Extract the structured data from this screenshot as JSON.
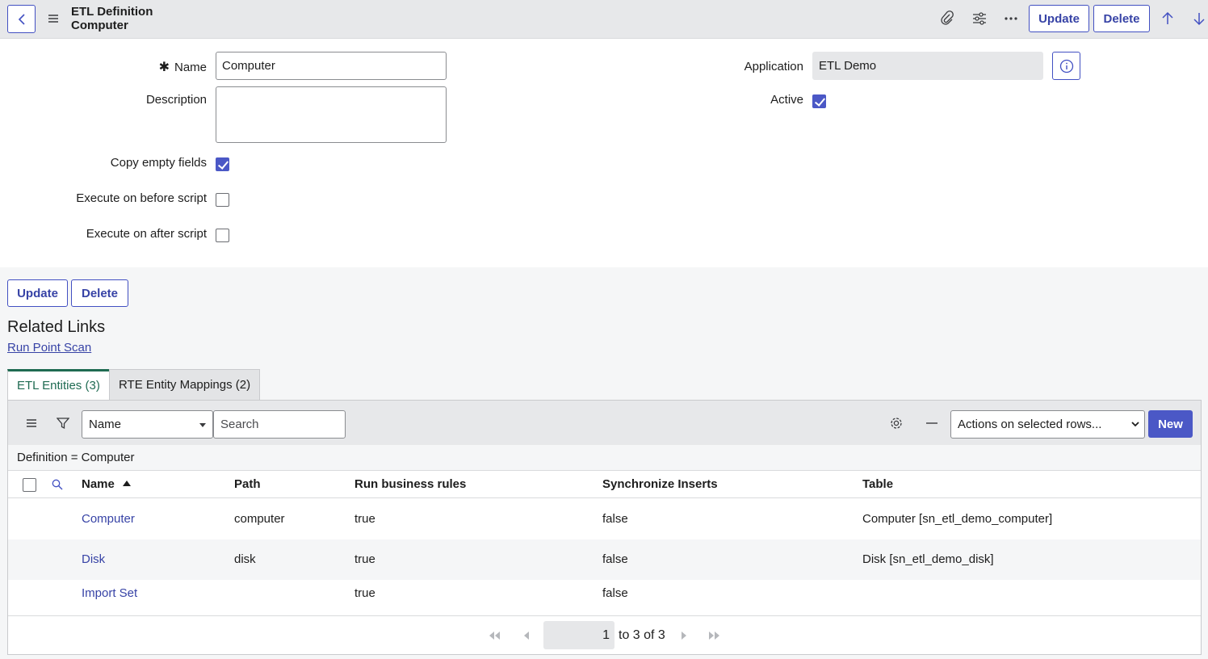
{
  "header": {
    "title_line1": "ETL Definition",
    "title_line2": "Computer",
    "update_label": "Update",
    "delete_label": "Delete"
  },
  "form": {
    "name_label": "Name",
    "name_required_marker": "✱",
    "name_value": "Computer",
    "description_label": "Description",
    "description_value": "",
    "copy_empty_label": "Copy empty fields",
    "copy_empty_checked": true,
    "exec_before_label": "Execute on before script",
    "exec_before_checked": false,
    "exec_after_label": "Execute on after script",
    "exec_after_checked": false,
    "application_label": "Application",
    "application_value": "ETL Demo",
    "active_label": "Active",
    "active_checked": true
  },
  "bottom_buttons": {
    "update_label": "Update",
    "delete_label": "Delete"
  },
  "related": {
    "title": "Related Links",
    "link_label": "Run Point Scan"
  },
  "tabs": [
    {
      "label": "ETL Entities (3)",
      "active": true
    },
    {
      "label": "RTE Entity Mappings (2)",
      "active": false
    }
  ],
  "list": {
    "search_field": "Name",
    "search_placeholder": "Search",
    "actions_select": "Actions on selected rows...",
    "new_label": "New",
    "breadcrumb": "Definition = Computer",
    "columns": [
      "Name",
      "Path",
      "Run business rules",
      "Synchronize Inserts",
      "Table"
    ],
    "rows": [
      {
        "name": "Computer",
        "path": "computer",
        "run_rules": "true",
        "sync": "false",
        "table": "Computer [sn_etl_demo_computer]"
      },
      {
        "name": "Disk",
        "path": "disk",
        "run_rules": "true",
        "sync": "false",
        "table": "Disk [sn_etl_demo_disk]"
      },
      {
        "name": "Import Set",
        "path": "",
        "run_rules": "true",
        "sync": "false",
        "table": ""
      }
    ],
    "pager_current": "1",
    "pager_text": "to 3 of 3"
  },
  "colors": {
    "accent": "#4b58c6",
    "tab_active": "#1f6b52",
    "link": "#3743a6"
  }
}
